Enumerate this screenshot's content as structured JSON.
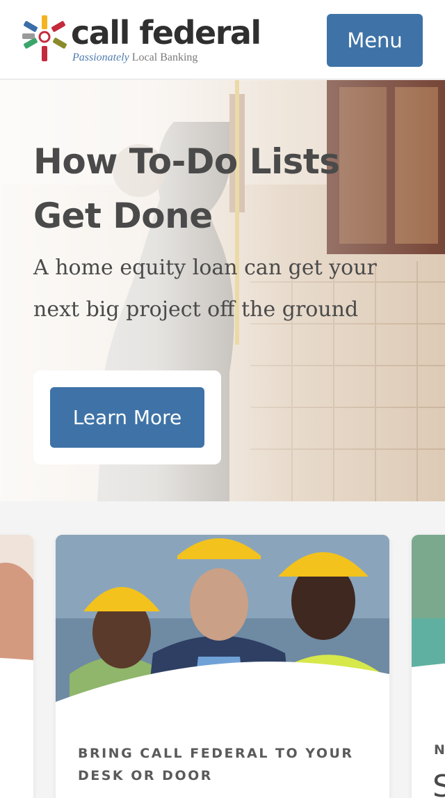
{
  "header": {
    "brand_name": "call federal",
    "tagline_em": "Passionately",
    "tagline_rest": " Local Banking",
    "menu_label": "Menu"
  },
  "hero": {
    "title": "How To-Do Lists Get Done",
    "subtitle": "A home equity loan can get your next big project off the ground",
    "cta_label": "Learn More"
  },
  "carousel": {
    "cards": [
      {
        "heading": "BRING CALL FEDERAL TO YOUR DESK OR DOOR"
      }
    ],
    "peek_right": {
      "label": "N",
      "big": "S"
    }
  },
  "colors": {
    "primary_blue": "#3f73a7",
    "text_dark": "#4a4a4a",
    "logo_yellow": "#f4b320",
    "logo_green": "#3aa56b",
    "logo_red": "#c42a3c",
    "logo_blue": "#3a6ea8",
    "logo_olive": "#8a8a2a"
  },
  "icons": {
    "logo": "call-federal-starburst-logo"
  }
}
